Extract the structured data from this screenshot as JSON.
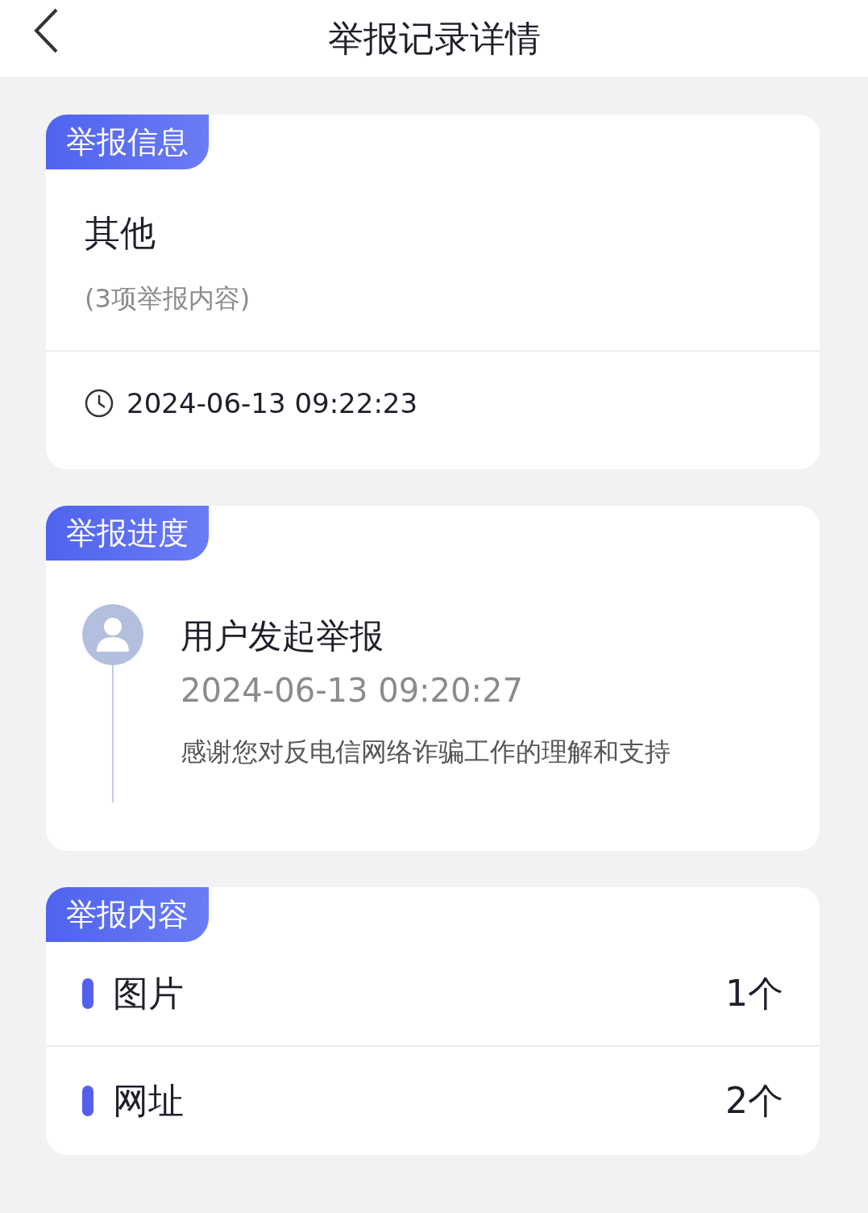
{
  "header": {
    "title": "举报记录详情"
  },
  "info": {
    "tag": "举报信息",
    "type": "其他",
    "summary": "(3项举报内容)",
    "time": "2024-06-13 09:22:23"
  },
  "progress": {
    "tag": "举报进度",
    "steps": [
      {
        "title": "用户发起举报",
        "time": "2024-06-13 09:20:27",
        "message": "感谢您对反电信网络诈骗工作的理解和支持"
      }
    ]
  },
  "content": {
    "tag": "举报内容",
    "items": [
      {
        "label": "图片",
        "count": "1个"
      },
      {
        "label": "网址",
        "count": "2个"
      }
    ]
  }
}
